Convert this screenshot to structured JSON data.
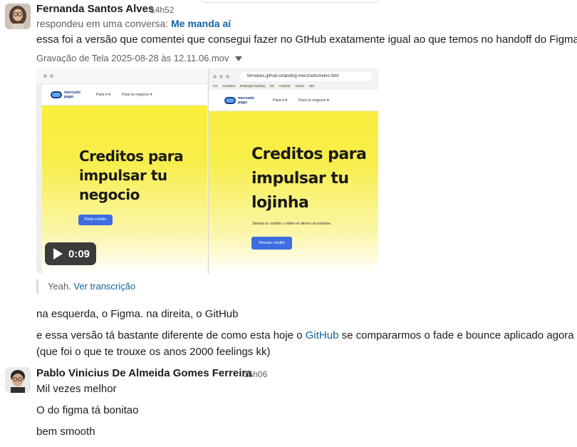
{
  "messages": [
    {
      "author": "Fernanda Santos Alves",
      "time": "14h52",
      "replied_prefix": "respondeu em uma conversa:",
      "replied_thread": "Me manda aí",
      "text": "essa foi a versão que comentei que consegui fazer no GtHub exatamente igual ao que temos no handoff do Figma",
      "attachment": {
        "file_name": "Gravação de Tela 2025-08-28 às 12.11.06.mov",
        "duration": "0:09",
        "left_pane": {
          "logo_text": "mercado pago",
          "nav_1": "Para ti ▾",
          "nav_2": "Para tu negocio ▾",
          "headline": "Creditos para impulsar tu negocio",
          "cta": "Pedir crédito"
        },
        "right_pane": {
          "url": "fernalves.github.io/landing-merchants/index.html",
          "bookmarks": [
            "UX",
            "Activities",
            "Redesign landing",
            "SC",
            "Holente",
            "Home",
            "Jira"
          ],
          "logo_text": "mercado pago",
          "nav_1": "Para ti ▾",
          "nav_2": "Para tu negocio ▾",
          "headline": "Creditos para impulsar tu lojinha",
          "subtitle": "Simula tu crédito y obtén el dinero al instante.",
          "cta": "Simular crédito"
        }
      },
      "transcript_prefix": "Yeah.",
      "transcript_link": "Ver transcrição",
      "followups": [
        "na esquerda, o Figma. na direita, o GitHub"
      ],
      "followup_2_before": "e essa versão tá bastante diferente de como esta hoje o ",
      "followup_2_link": "GitHub",
      "followup_2_after": " se compararmos o fade e bounce aplicado agora",
      "followup_2_line2": "(que foi o que te trouxe os anos 2000 feelings kk)"
    },
    {
      "author": "Pablo Vinicius De Almeida Gomes Ferreira",
      "time": "15h06",
      "lines": [
        "Mil vezes melhor",
        "O do figma tá bonitao",
        "bem smooth"
      ]
    }
  ],
  "colors": {
    "link": "#1264a3",
    "muted": "#616061",
    "yellow": "#fbef33",
    "cta_blue": "#3d6de1"
  }
}
